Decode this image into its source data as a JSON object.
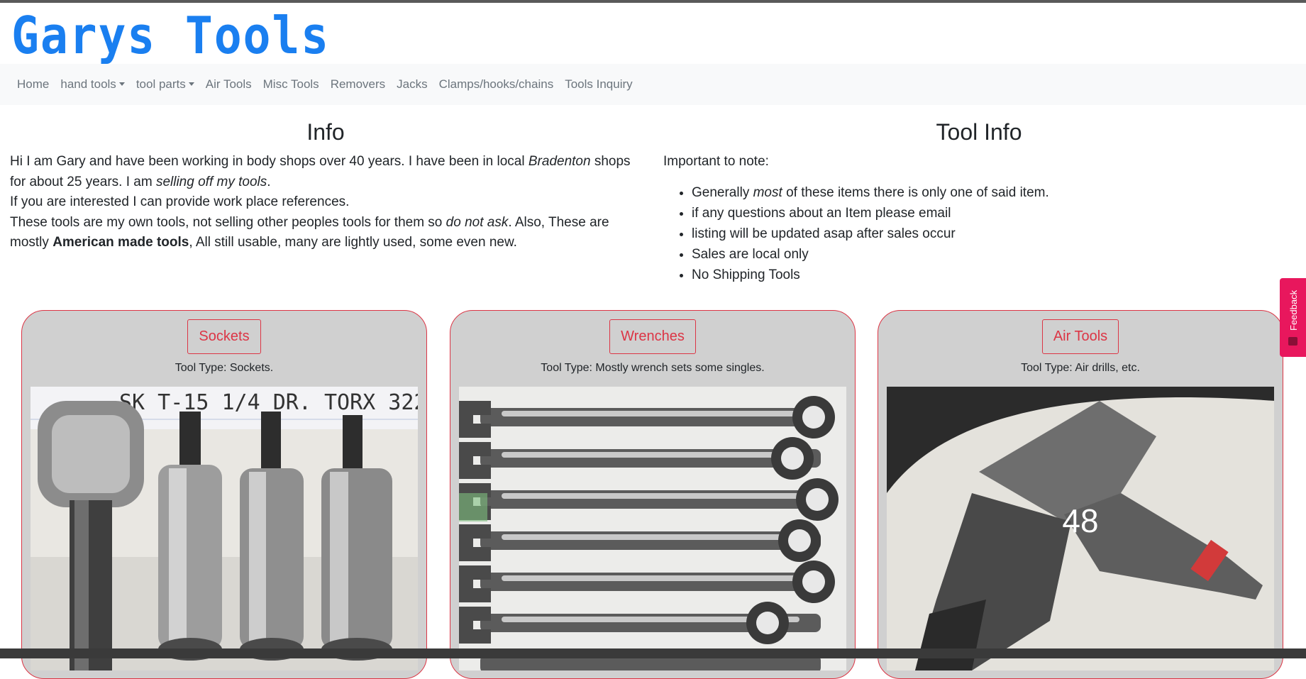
{
  "site": {
    "brand": "Garys Tools"
  },
  "nav": {
    "items": [
      {
        "label": "Home",
        "dropdown": false
      },
      {
        "label": "hand tools",
        "dropdown": true
      },
      {
        "label": "tool parts",
        "dropdown": true
      },
      {
        "label": "Air Tools",
        "dropdown": false
      },
      {
        "label": "Misc Tools",
        "dropdown": false
      },
      {
        "label": "Removers",
        "dropdown": false
      },
      {
        "label": "Jacks",
        "dropdown": false
      },
      {
        "label": "Clamps/hooks/chains",
        "dropdown": false
      },
      {
        "label": "Tools Inquiry",
        "dropdown": false
      }
    ]
  },
  "info": {
    "title": "Info",
    "p1_a": "Hi I am Gary and have been working in body shops over 40 years. I have been in local ",
    "p1_em": "Bradenton",
    "p1_b": " shops for about 25 years. I am ",
    "p1_em2": "selling off my tools",
    "p1_c": ".",
    "p2": "If you are interested I can provide work place references.",
    "p3_a": "These tools are my own tools, not selling other peoples tools for them so ",
    "p3_em": "do not ask",
    "p3_b": ". Also, These are mostly ",
    "p3_strong": "American made tools",
    "p3_c": ", All still usable, many are lightly used, some even new."
  },
  "tool_info": {
    "title": "Tool Info",
    "intro": "Important to note:",
    "bullet1_a": "Generally ",
    "bullet1_em": "most",
    "bullet1_b": " of these items there is only one of said item.",
    "bullet2": "if any questions about an Item please email",
    "bullet3": "listing will be updated asap after sales occur",
    "bullet4": "Sales are local only",
    "bullet5": "No Shipping Tools"
  },
  "cards": [
    {
      "button": "Sockets",
      "type": "Tool Type: Sockets.",
      "photo_text": "SK T-15  1/4 DR. TORX  322"
    },
    {
      "button": "Wrenches",
      "type": "Tool Type: Mostly wrench sets some singles.",
      "photo_text": ""
    },
    {
      "button": "Air Tools",
      "type": "Tool Type: Air drills, etc.",
      "overlay": "48"
    }
  ],
  "feedback": {
    "label": "Feedback"
  },
  "colors": {
    "brand": "#1a7ff0",
    "accent": "#dc3545",
    "card_bg": "#d0d0d0",
    "nav_bg": "#f8f9fa",
    "feedback": "#e8175d"
  }
}
